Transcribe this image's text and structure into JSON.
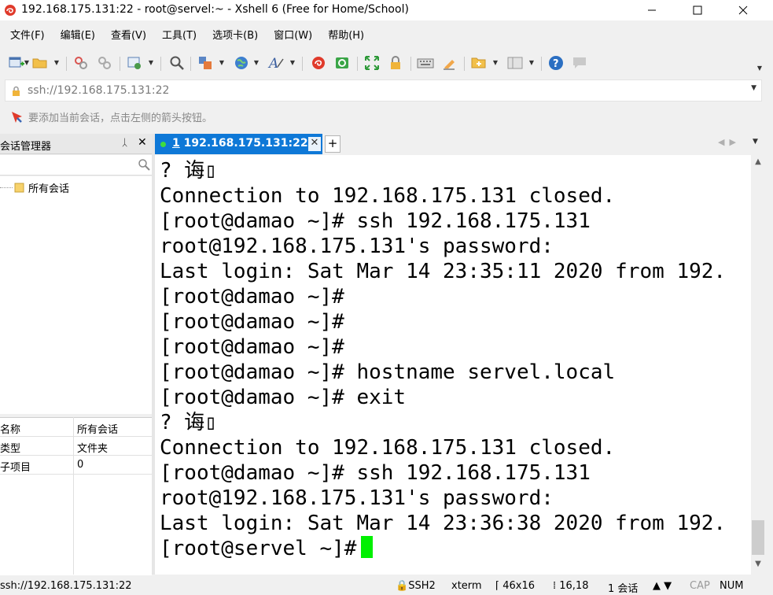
{
  "window": {
    "title": "192.168.175.131:22 - root@servel:~ - Xshell 6 (Free for Home/School)",
    "minimize": "—",
    "maximize": "☐",
    "close": "✕"
  },
  "menu": [
    "文件(F)",
    "编辑(E)",
    "查看(V)",
    "工具(T)",
    "选项卡(B)",
    "窗口(W)",
    "帮助(H)"
  ],
  "address": {
    "value": "ssh://192.168.175.131:22"
  },
  "hint": {
    "text": "要添加当前会话，点击左侧的箭头按钮。"
  },
  "session_manager": {
    "title": "会话管理器",
    "pin": "ᛸ",
    "close": "✕",
    "tree_item": "所有会话",
    "props": [
      {
        "name": "名称",
        "value": "所有会话"
      },
      {
        "name": "类型",
        "value": "文件夹"
      },
      {
        "name": "子项目",
        "value": "0"
      }
    ]
  },
  "tab": {
    "number": "1",
    "label": "192.168.175.131:22",
    "close": "✕",
    "add": "+"
  },
  "terminal": {
    "lines": [
      "? 诲▯",
      "Connection to 192.168.175.131 closed.",
      "[root@damao ~]# ssh 192.168.175.131",
      "root@192.168.175.131's password:",
      "Last login: Sat Mar 14 23:35:11 2020 from 192.",
      "[root@damao ~]#",
      "[root@damao ~]#",
      "[root@damao ~]#",
      "[root@damao ~]# hostname servel.local",
      "[root@damao ~]# exit",
      "? 诲▯",
      "Connection to 192.168.175.131 closed.",
      "[root@damao ~]# ssh 192.168.175.131",
      "root@192.168.175.131's password:",
      "Last login: Sat Mar 14 23:36:38 2020 from 192.",
      "[root@servel ~]#"
    ]
  },
  "status": {
    "url": "ssh://192.168.175.131:22",
    "protocol": "SSH2",
    "term": "xterm",
    "size": "46x16",
    "cursor_pos": "16,18",
    "sessions": "1 会话",
    "cap": "CAP",
    "num": "NUM"
  },
  "colors": {
    "tab_active": "#0e78d7",
    "cursor": "#00f000"
  }
}
